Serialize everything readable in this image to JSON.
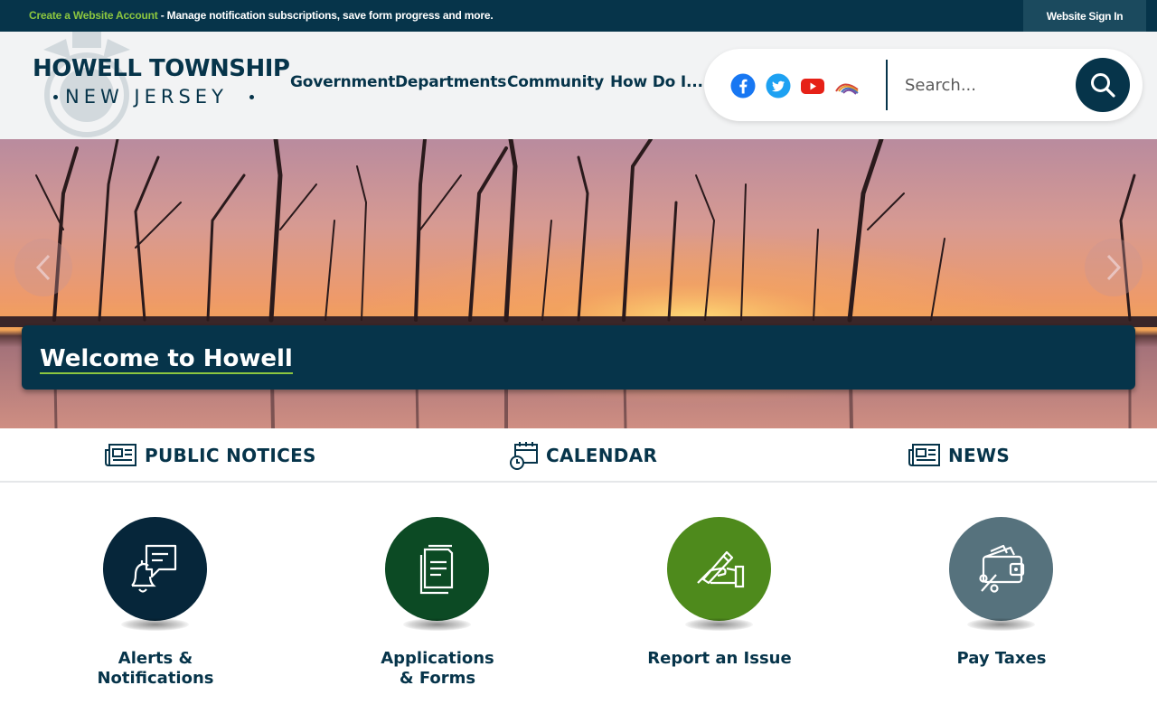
{
  "topbar": {
    "create_account_link": "Create a Website Account",
    "message": " - Manage notification subscriptions, save form progress and more.",
    "signin_label": "Website Sign In"
  },
  "header": {
    "logo_title": "HOWELL TOWNSHIP",
    "logo_subtitle": "NEW JERSEY"
  },
  "nav": {
    "items": [
      {
        "label": "Government"
      },
      {
        "label": "Departments"
      },
      {
        "label": "Community"
      },
      {
        "label": "How Do I..."
      }
    ]
  },
  "social": {
    "icons": [
      "facebook-icon",
      "twitter-icon",
      "youtube-icon",
      "swagit-icon"
    ]
  },
  "search": {
    "placeholder": "Search...",
    "icon": "search-icon"
  },
  "hero": {
    "caption": "Welcome to Howell",
    "prev_icon": "chevron-left-icon",
    "next_icon": "chevron-right-icon"
  },
  "quicklinks": [
    {
      "label": "PUBLIC NOTICES",
      "icon": "newspaper-icon"
    },
    {
      "label": "CALENDAR",
      "icon": "calendar-clock-icon"
    },
    {
      "label": "NEWS",
      "icon": "newspaper-icon"
    }
  ],
  "circles": [
    {
      "label": "Alerts &\nNotifications",
      "icon": "bell-chat-icon",
      "color": "#06263a"
    },
    {
      "label": "Applications\n& Forms",
      "icon": "documents-icon",
      "color": "#0c4a24"
    },
    {
      "label": "Report an Issue",
      "icon": "hand-pen-icon",
      "color": "#4e8a1c"
    },
    {
      "label": "Pay Taxes",
      "icon": "wallet-percent-icon",
      "color": "#56727d"
    }
  ],
  "colors": {
    "navy": "#06344a",
    "accent_green": "#8cc63f"
  }
}
